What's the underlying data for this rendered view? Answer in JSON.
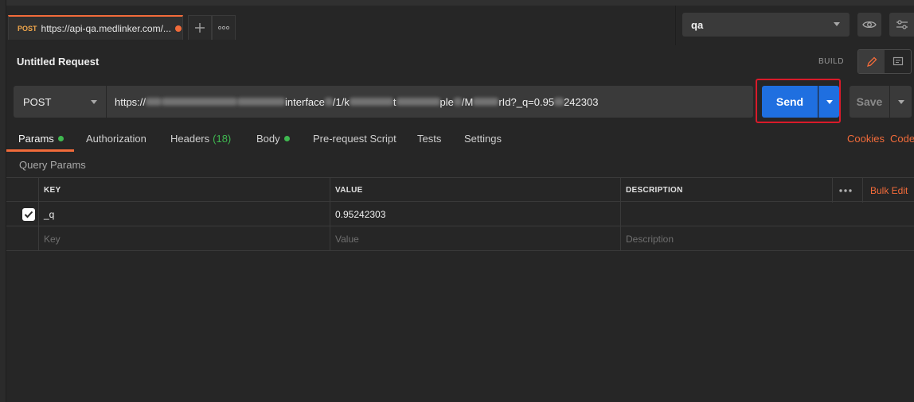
{
  "tabs": {
    "active": {
      "method": "POST",
      "url": "https://api-qa.medlinker.com/...",
      "unsaved": true
    },
    "new_tab_icon": "plus-icon",
    "more_icon": "ellipsis-icon"
  },
  "environment": {
    "selected": "qa",
    "quick_look_icon": "eye-icon",
    "settings_icon": "sliders-icon"
  },
  "request": {
    "title": "Untitled Request",
    "mode_label": "BUILD",
    "edit_icon": "pencil-icon",
    "comment_icon": "comment-icon",
    "method": "POST",
    "url_prefix": "https://",
    "url_seg1": "interface",
    "url_seg2": "/1/k",
    "url_seg3": "t",
    "url_seg4": "ple",
    "url_seg5": "/M",
    "url_seg6": "rId?_q=0.95",
    "url_seg7": "242303",
    "send_label": "Send",
    "save_label": "Save"
  },
  "sub_tabs": {
    "params": "Params",
    "authorization": "Authorization",
    "headers": "Headers",
    "headers_count": "(18)",
    "body": "Body",
    "pre_request": "Pre-request Script",
    "tests": "Tests",
    "settings": "Settings",
    "cookies": "Cookies",
    "code": "Code"
  },
  "query_params": {
    "title": "Query Params",
    "columns": {
      "key": "KEY",
      "value": "VALUE",
      "description": "DESCRIPTION"
    },
    "bulk_edit": "Bulk Edit",
    "rows": [
      {
        "checked": true,
        "key": "_q",
        "value": "0.95242303",
        "description": ""
      }
    ],
    "placeholders": {
      "key": "Key",
      "value": "Value",
      "description": "Description"
    }
  },
  "colors": {
    "accent": "#f26b3a",
    "send_blue": "#1f6fe0",
    "highlight_red": "#d91a2a",
    "status_green": "#3fb950"
  }
}
